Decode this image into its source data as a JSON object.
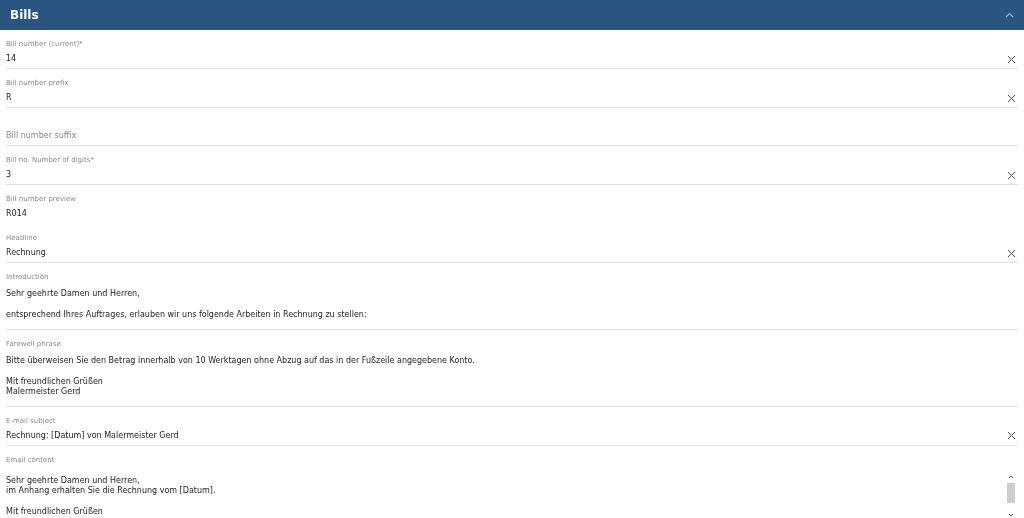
{
  "panel": {
    "title": "Bills",
    "expanded": true
  },
  "fields": [
    {
      "kind": "input",
      "label": "Bill number (current)*",
      "value": "14"
    },
    {
      "kind": "input",
      "label": "Bill number prefix",
      "value": "R"
    },
    {
      "kind": "placeholder",
      "placeholder": "Bill number suffix"
    },
    {
      "kind": "input",
      "label": "Bill no. Number of digits*",
      "value": "3"
    },
    {
      "kind": "readonly",
      "label": "Bill number preview",
      "value": "R014"
    },
    {
      "kind": "input",
      "label": "Headline",
      "value": "Rechnung"
    },
    {
      "kind": "textarea",
      "label": "Introduction",
      "value": "Sehr geehrte Damen und Herren,\n\nentsprechend Ihres Auftrages, erlauben wir uns folgende Arbeiten in Rechnung zu stellen:"
    },
    {
      "kind": "textarea",
      "label": "Farewell phrase",
      "value": "Bitte überweisen Sie den Betrag innerhalb von 10 Werktagen ohne Abzug auf das in der Fußzeile angegebene Konto.\n\nMit freundlichen Grüßen\nMalermeister Gerd"
    },
    {
      "kind": "input",
      "label": "E-mail subject",
      "value": "Rechnung: [Datum] von Malermeister Gerd"
    },
    {
      "kind": "scrollarea",
      "label": "Email content",
      "value": "Sehr geehrte Damen und Herren,\nim Anhang erhalten Sie die Rechnung vom [Datum].\n\nMit freundlichen Grüßen"
    }
  ]
}
